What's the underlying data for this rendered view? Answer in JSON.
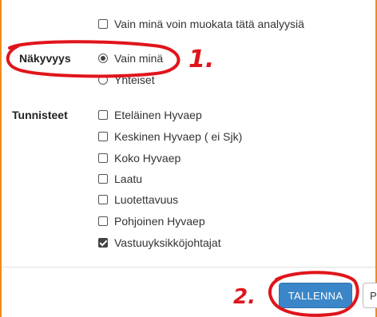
{
  "edit_permission": {
    "label": "Vain minä voin muokata tätä analyysiä",
    "checked": false
  },
  "visibility": {
    "label": "Näkyvyys",
    "options": [
      {
        "label": "Vain minä",
        "selected": true
      },
      {
        "label": "Yhteiset",
        "selected": false
      }
    ]
  },
  "tags": {
    "label": "Tunnisteet",
    "options": [
      {
        "label": "Eteläinen Hyvaep",
        "checked": false
      },
      {
        "label": "Keskinen Hyvaep ( ei Sjk)",
        "checked": false
      },
      {
        "label": "Koko Hyvaep",
        "checked": false
      },
      {
        "label": "Laatu",
        "checked": false
      },
      {
        "label": "Luotettavuus",
        "checked": false
      },
      {
        "label": "Pohjoinen Hyvaep",
        "checked": false
      },
      {
        "label": "Vastuuyksikköjohtajat",
        "checked": true
      }
    ]
  },
  "buttons": {
    "save_label": "TALLENNA",
    "next_label": "P"
  },
  "annotations": {
    "marker_1": "1.",
    "marker_2": "2.",
    "color": "#e0151b"
  },
  "colors": {
    "frame": "#f08a1c",
    "primary_button": "#3a86c8"
  }
}
